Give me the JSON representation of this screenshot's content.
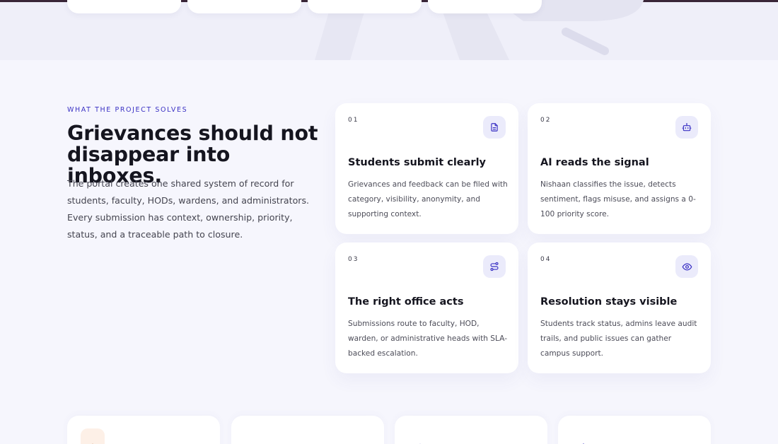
{
  "section": {
    "eyebrow": "WHAT THE PROJECT SOLVES",
    "title": "Grievances should not disappear into inboxes.",
    "description": "The portal creates one shared system of record for students, faculty, HODs, wardens, and administrators. Every submission has context, ownership, priority, status, and a traceable path to closure."
  },
  "steps": [
    {
      "number": "01",
      "icon": "document-icon",
      "title": "Students submit clearly",
      "description": "Grievances and feedback can be filed with category, visibility, anonymity, and supporting context."
    },
    {
      "number": "02",
      "icon": "robot-icon",
      "title": "AI reads the signal",
      "description": "Nishaan classifies the issue, detects sentiment, flags misuse, and assigns a 0-100 priority score."
    },
    {
      "number": "03",
      "icon": "route-icon",
      "title": "The right office acts",
      "description": "Submissions route to faculty, HOD, warden, or administrative heads with SLA-backed escalation."
    },
    {
      "number": "04",
      "icon": "eye-icon",
      "title": "Resolution stays visible",
      "description": "Students track status, admins leave audit trails, and public issues can gather campus support."
    }
  ],
  "bottom_cards": [
    {
      "icon": "lock-icon"
    },
    {
      "icon": "shield-check-icon"
    },
    {
      "icon": "bar-chart-icon"
    },
    {
      "icon": "sparkle-icon"
    }
  ],
  "colors": {
    "accent": "#3b32c4",
    "background": "#f6f6fd",
    "card": "#ffffff",
    "icon_bg": "#ebebfb"
  }
}
